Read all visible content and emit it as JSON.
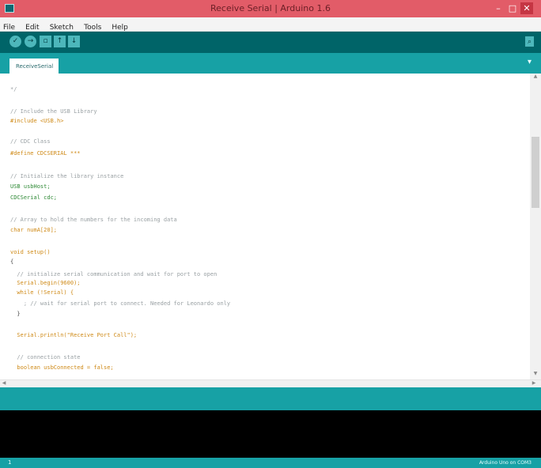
{
  "window": {
    "title": "Receive Serial | Arduino 1.6",
    "controls": [
      "–",
      "□",
      "✕"
    ]
  },
  "menu": [
    "File",
    "Edit",
    "Sketch",
    "Tools",
    "Help"
  ],
  "toolbar": {
    "buttons": [
      {
        "icon": "verify-icon",
        "glyph": "✓"
      },
      {
        "icon": "upload-icon",
        "glyph": "→"
      },
      {
        "icon": "new-icon",
        "glyph": "▫"
      },
      {
        "icon": "open-icon",
        "glyph": "↑"
      },
      {
        "icon": "save-icon",
        "glyph": "↓"
      }
    ],
    "serial_monitor_glyph": "⌕"
  },
  "tab": {
    "label": "ReceiveSerial",
    "menu_glyph": "▾"
  },
  "editor": {
    "lines": [
      {
        "text": "*/",
        "cls": "cm"
      },
      {
        "text": "// Include the USB Library",
        "cls": "cm"
      },
      {
        "text": "#include <USB.h>",
        "cls": "kw"
      },
      {
        "text": "// CDC Class",
        "cls": "cm"
      },
      {
        "text": "#define CDCSERIAL ***",
        "cls": "kw"
      },
      {
        "text": "// Initialize the library instance",
        "cls": "cm"
      },
      {
        "text": "USB usbHost;",
        "cls": "kw2"
      },
      {
        "text": "CDCSerial cdc;",
        "cls": "kw2"
      },
      {
        "text": "// Array to hold the numbers for the incoming data",
        "cls": "cm"
      },
      {
        "text": "char numA[20];",
        "cls": "kw"
      },
      {
        "text": "void setup()",
        "cls": "kw"
      },
      {
        "text": "{",
        "cls": ""
      },
      {
        "text": "  // initialize serial communication and wait for port to open",
        "cls": "cm"
      },
      {
        "text": "  Serial.begin(9600);",
        "cls": "kw"
      },
      {
        "text": "  while (!Serial) {",
        "cls": "kw"
      },
      {
        "text": "    ; // wait for serial port to connect. Needed for Leonardo only",
        "cls": "cm"
      },
      {
        "text": "  }",
        "cls": ""
      },
      {
        "text": "  Serial.println(\"Receive Port Call\");",
        "cls": "kw"
      },
      {
        "text": "  // connection state",
        "cls": "cm"
      },
      {
        "text": "  boolean usbConnected = false;",
        "cls": "kw"
      }
    ]
  },
  "status": {
    "line_number": "1",
    "board": "Arduino Uno on COM3"
  },
  "colors": {
    "titlebar": "#e25c68",
    "toolbar": "#006468",
    "teal": "#17a1a5",
    "console": "#000000"
  }
}
